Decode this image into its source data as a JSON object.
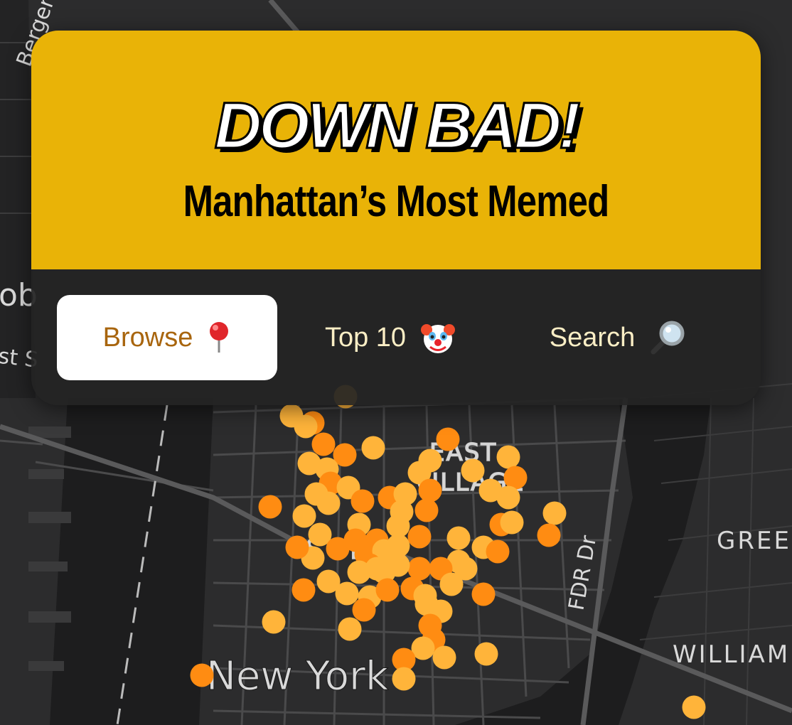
{
  "header": {
    "title": "DOWN BAD!",
    "subtitle": "Manhattan’s Most Memed"
  },
  "nav": {
    "browse": {
      "label": "Browse",
      "icon": "pushpin-icon",
      "active": true
    },
    "top10": {
      "label": "Top 10",
      "icon": "clown-face-icon",
      "active": false
    },
    "search": {
      "label": "Search",
      "icon": "magnifying-glass-icon",
      "active": false
    }
  },
  "map": {
    "labels": {
      "bergen": "Bergen",
      "hoboken_fragment": "ob",
      "st_fragment": "st S",
      "east_village": "EAST\nVILLAGE",
      "soho": "SOHO",
      "fdr": "FDR Dr",
      "greenpoint": "GREEN",
      "williamsburg": "WILLIAM",
      "new_york": "New York"
    },
    "marker_colors": [
      "#ffb43a",
      "#ff8c12",
      "#ff3a10"
    ]
  },
  "colors": {
    "accent": "#e9b307",
    "active_text": "#a8650e",
    "nav_text": "#fbeec5",
    "map_bg": "#2a2a2b"
  }
}
